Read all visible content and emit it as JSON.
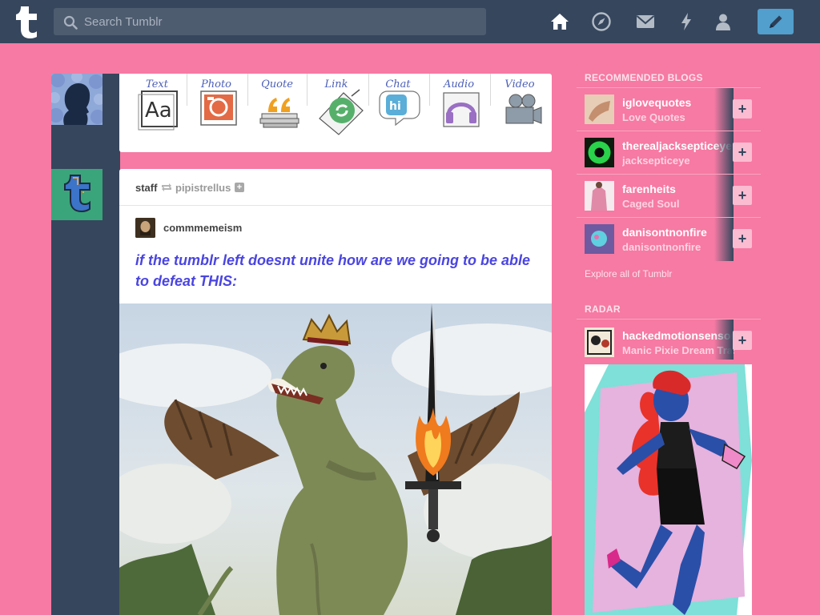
{
  "header": {
    "search_placeholder": "Search Tumblr"
  },
  "composer": {
    "types": [
      {
        "label": "Text"
      },
      {
        "label": "Photo"
      },
      {
        "label": "Quote"
      },
      {
        "label": "Link"
      },
      {
        "label": "Chat"
      },
      {
        "label": "Audio"
      },
      {
        "label": "Video"
      }
    ]
  },
  "post": {
    "reblogger": "staff",
    "reblogged_from": "pipistrellus",
    "follow_symbol": "+",
    "source_blog": "commmemeism",
    "text": "if the tumblr left doesnt unite how are we going to be able to defeat THIS:"
  },
  "sidebar": {
    "recommended_title": "RECOMMENDED BLOGS",
    "blogs": [
      {
        "name": "iglovequotes",
        "title": "Love Quotes"
      },
      {
        "name": "therealjacksepticeye",
        "title": "jacksepticeye"
      },
      {
        "name": "farenheits",
        "title": "Caged Soul"
      },
      {
        "name": "danisontnonfire",
        "title": "danisontnonfire"
      }
    ],
    "follow_symbol": "+",
    "explore_label": "Explore all of Tumblr",
    "radar_title": "RADAR",
    "radar_blog": {
      "name": "hackedmotionsensor",
      "title": "Manic Pixie Dream Trash"
    }
  },
  "colors": {
    "background": "#f67aa3",
    "navbar": "#36465d",
    "compose_button": "#529ecc",
    "post_text": "#4a45e0"
  }
}
